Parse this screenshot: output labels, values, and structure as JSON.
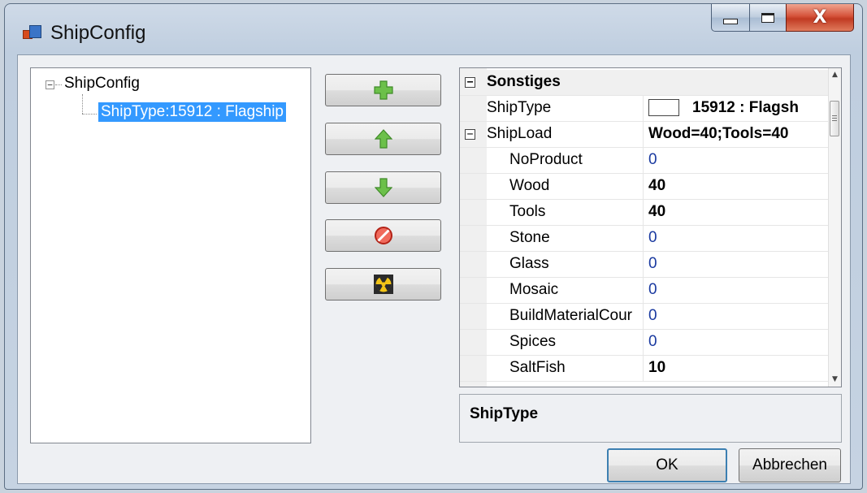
{
  "window": {
    "title": "ShipConfig",
    "icon": "app-window-icon",
    "controls": [
      "minimize-icon",
      "maximize-icon",
      "close-icon"
    ],
    "close_glyph": "X"
  },
  "tree": {
    "root_label": "ShipConfig",
    "root_expander": "−",
    "child_label": "ShipType:15912 : Flagship"
  },
  "toolbar": {
    "buttons": [
      {
        "name": "add-button",
        "icon": "plus-icon",
        "color": "#5cb338"
      },
      {
        "name": "move-up-button",
        "icon": "arrow-up-icon",
        "color": "#5cb338"
      },
      {
        "name": "move-down-button",
        "icon": "arrow-down-icon",
        "color": "#5cb338"
      },
      {
        "name": "remove-button",
        "icon": "no-entry-icon",
        "color": "#d9352a"
      },
      {
        "name": "clear-button",
        "icon": "radiation-icon",
        "color": "#f2c417"
      }
    ]
  },
  "propgrid": {
    "category": "Sonstiges",
    "category_expander": "⊟",
    "shiptype": {
      "name": "ShipType",
      "value": "15912 : Flagsh"
    },
    "shipload": {
      "name": "ShipLoad",
      "value": "Wood=40;Tools=40",
      "expander": "⊟"
    },
    "items": [
      {
        "name": "NoProduct",
        "value": "0",
        "bold": false
      },
      {
        "name": "Wood",
        "value": "40",
        "bold": true
      },
      {
        "name": "Tools",
        "value": "40",
        "bold": true
      },
      {
        "name": "Stone",
        "value": "0",
        "bold": false
      },
      {
        "name": "Glass",
        "value": "0",
        "bold": false
      },
      {
        "name": "Mosaic",
        "value": "0",
        "bold": false
      },
      {
        "name": "BuildMaterialCour",
        "value": "0",
        "bold": false
      },
      {
        "name": "Spices",
        "value": "0",
        "bold": false
      },
      {
        "name": "SaltFish",
        "value": "10",
        "bold": true
      }
    ],
    "scroll_up": "▲",
    "scroll_down": "▼"
  },
  "description": {
    "title": "ShipType"
  },
  "buttons": {
    "ok": "OK",
    "cancel": "Abbrechen"
  }
}
